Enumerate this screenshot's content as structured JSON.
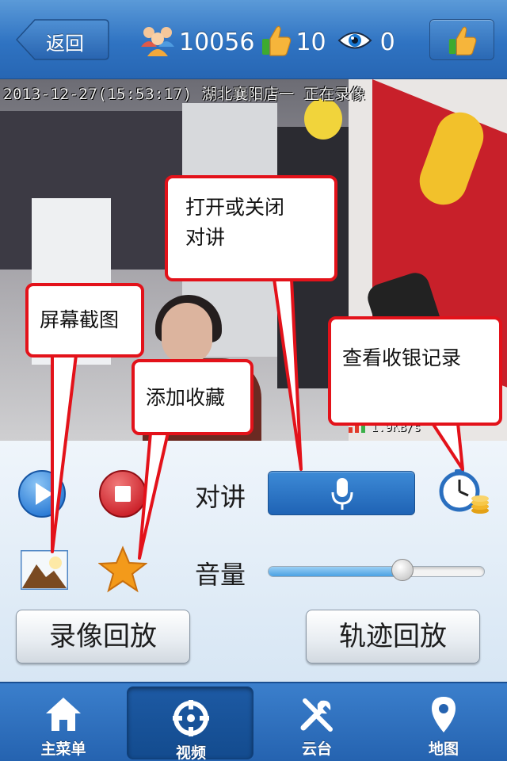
{
  "header": {
    "back_label": "返回",
    "followers_count": "10056",
    "likes_count": "10",
    "views_count": "0"
  },
  "video": {
    "osd_text": "2013-12-27(15:53:17) 湖北襄阳店一 正在录像",
    "speed_text": "1.9KB/s"
  },
  "controls": {
    "talk_label": "对讲",
    "volume_label": "音量",
    "volume_level": 0.62,
    "playback_label": "录像回放",
    "track_label": "轨迹回放"
  },
  "tabs": [
    {
      "label": "主菜单",
      "icon": "home-icon",
      "active": false
    },
    {
      "label": "视频",
      "icon": "crosshair-icon",
      "active": true
    },
    {
      "label": "云台",
      "icon": "tools-icon",
      "active": false
    },
    {
      "label": "地图",
      "icon": "map-pin-icon",
      "active": false
    }
  ],
  "callouts": {
    "talk": "打开或关闭\n对讲",
    "screenshot": "屏幕截图",
    "favorite": "添加收藏",
    "cashier": "查看收银记录"
  },
  "colors": {
    "header_blue": "#2f73c2",
    "callout_red": "#e3121a",
    "talk_button": "#1f63b5"
  }
}
